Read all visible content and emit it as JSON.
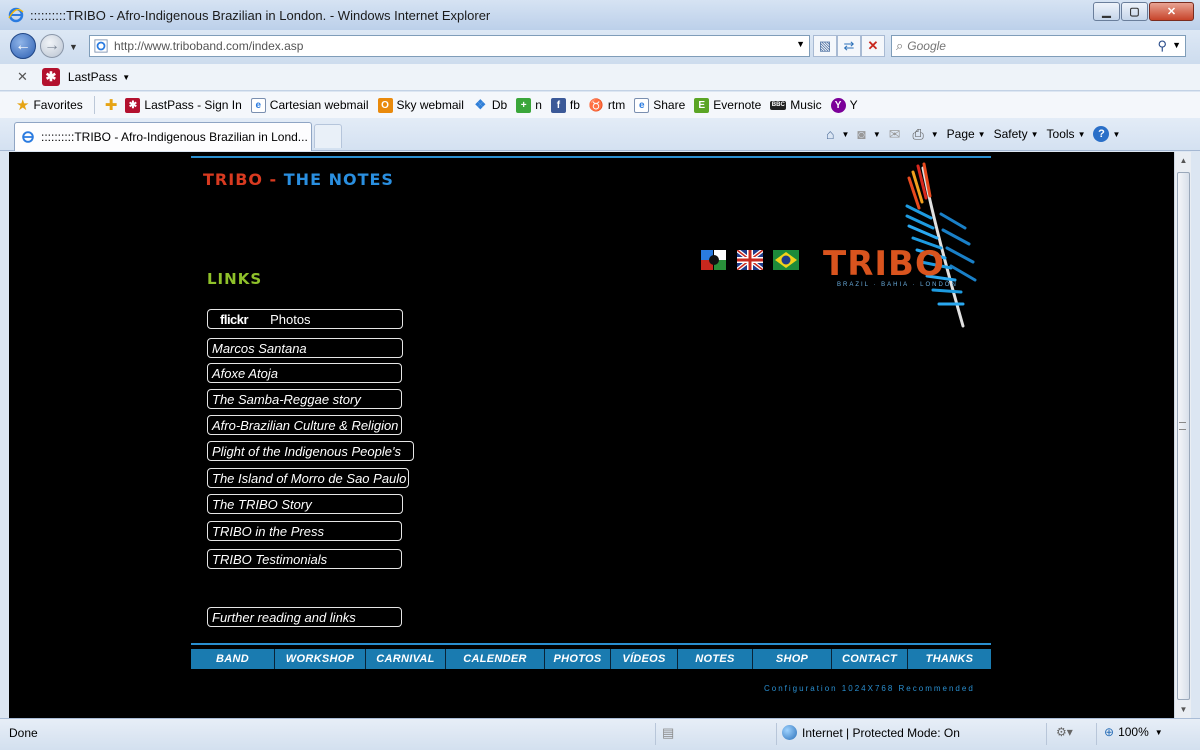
{
  "window": {
    "title": "::::::::::TRIBO - Afro-Indigenous Brazilian in London. - Windows Internet Explorer",
    "controls": [
      "minimize",
      "maximize",
      "close"
    ]
  },
  "addressbar": {
    "url": "http://www.triboband.com/index.asp",
    "search_placeholder": "Google"
  },
  "lastpass_bar": {
    "label": "LastPass"
  },
  "favorites": {
    "label": "Favorites",
    "items": [
      {
        "label": "LastPass - Sign In",
        "icon": "lastpass-icon"
      },
      {
        "label": "Cartesian webmail",
        "icon": "ie-page-icon"
      },
      {
        "label": "Sky webmail",
        "icon": "outlook-icon"
      },
      {
        "label": "Db",
        "icon": "dropbox-icon"
      },
      {
        "label": "n",
        "icon": "plus-icon"
      },
      {
        "label": "fb",
        "icon": "facebook-icon"
      },
      {
        "label": "rtm",
        "icon": "cow-icon"
      },
      {
        "label": "Share",
        "icon": "ie-page-icon"
      },
      {
        "label": "Evernote",
        "icon": "evernote-icon"
      },
      {
        "label": "Music",
        "icon": "bbc-icon"
      },
      {
        "label": "Y",
        "icon": "yahoo-icon"
      }
    ]
  },
  "tab": {
    "label": "::::::::::TRIBO - Afro-Indigenous Brazilian in Lond..."
  },
  "commandbar": {
    "page": "Page",
    "safety": "Safety",
    "tools": "Tools",
    "help_icon": "?"
  },
  "site": {
    "heading_part1": "TRIBO",
    "heading_dash": " - ",
    "heading_part2": "THE NOTES",
    "links_title": "LINKS",
    "logo_word": "TRIBO",
    "logo_sub": "BRAZIL · BAHIA · LONDON",
    "flickr_logo": "flickr",
    "links": [
      "Photos",
      "Marcos Santana",
      "Afoxe Atoja",
      "The Samba-Reggae story",
      "Afro-Brazilian Culture & Religion",
      "Plight of the Indigenous People's",
      "The Island of Morro de Sao Paulo",
      "The TRIBO Story",
      "TRIBO in the Press",
      "TRIBO Testimonials",
      "Further reading and links"
    ],
    "nav": [
      "BAND",
      "WORKSHOP",
      "CARNIVAL",
      "CALENDER",
      "PHOTOS",
      "VÍDEOS",
      "NOTES",
      "SHOP",
      "CONTACT",
      "THANKS"
    ],
    "config_note": "Configuration 1024X768 Recommended"
  },
  "statusbar": {
    "status": "Done",
    "zone": "Internet | Protected Mode: On",
    "zoom": "100%"
  },
  "colors": {
    "nav_bg": "#1a7bb0",
    "accent_line": "#2a8fd0",
    "heading_red": "#d83a20",
    "heading_blue": "#2a8fe0",
    "links_green": "#8fc12a",
    "logo_orange": "#d9541e"
  }
}
